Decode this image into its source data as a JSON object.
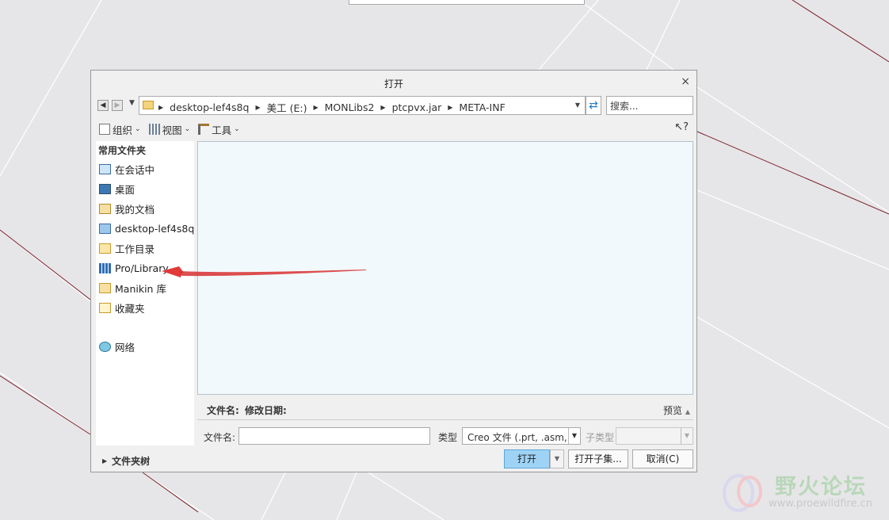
{
  "dialog": {
    "title": "打开",
    "close_label": "×"
  },
  "navigation": {
    "breadcrumbs": [
      "desktop-lef4s8q",
      "美工 (E:)",
      "MONLibs2",
      "ptcpvx.jar",
      "META-INF"
    ],
    "search_placeholder": "搜索..."
  },
  "toolbar": {
    "organize": "组织",
    "view": "视图",
    "tools": "工具",
    "help": "?"
  },
  "sidebar": {
    "header": "常用文件夹",
    "items": [
      {
        "label": "在会话中",
        "icon": "monitor-icon"
      },
      {
        "label": "桌面",
        "icon": "desktop-icon"
      },
      {
        "label": "我的文档",
        "icon": "documents-icon"
      },
      {
        "label": "desktop-lef4s8q",
        "icon": "computer-icon"
      },
      {
        "label": "工作目录",
        "icon": "working-folder-icon"
      },
      {
        "label": "Pro/Library",
        "icon": "library-icon"
      },
      {
        "label": "Manikin 库",
        "icon": "manikin-library-icon"
      },
      {
        "label": "收藏夹",
        "icon": "favorites-icon"
      },
      {
        "label": "网络",
        "icon": "network-icon"
      }
    ]
  },
  "details": {
    "filename_header": "文件名:",
    "modified_header": "修改日期:",
    "preview_label": "预览"
  },
  "file_row": {
    "filename_label": "文件名:",
    "filename_value": "",
    "type_label": "类型",
    "type_value": "Creo 文件 (.prt, .asm,",
    "subtype_label": "子类型"
  },
  "footer": {
    "folder_tree": "文件夹树",
    "open": "打开",
    "open_subset": "打开子集...",
    "cancel": "取消(C)"
  },
  "watermark": {
    "title": "野火论坛",
    "url": "www.proewildfire.cn"
  },
  "colors": {
    "primary_button": "#9fd3f5",
    "annotation_arrow": "#e03a3a",
    "content_bg": "#f2f9fc"
  }
}
